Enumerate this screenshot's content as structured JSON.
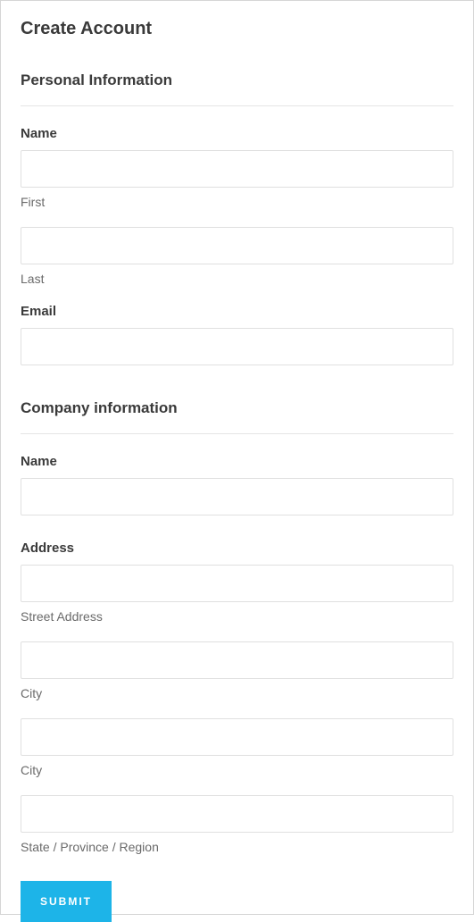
{
  "page": {
    "title": "Create Account"
  },
  "personal": {
    "section_title": "Personal Information",
    "name_label": "Name",
    "first_value": "",
    "first_sub": "First",
    "last_value": "",
    "last_sub": "Last",
    "email_label": "Email",
    "email_value": ""
  },
  "company": {
    "section_title": "Company information",
    "name_label": "Name",
    "name_value": "",
    "address_label": "Address",
    "street_value": "",
    "street_sub": "Street Address",
    "city1_value": "",
    "city1_sub": "City",
    "city2_value": "",
    "city2_sub": "City",
    "region_value": "",
    "region_sub": "State / Province / Region"
  },
  "actions": {
    "submit_label": "SUBMIT"
  }
}
